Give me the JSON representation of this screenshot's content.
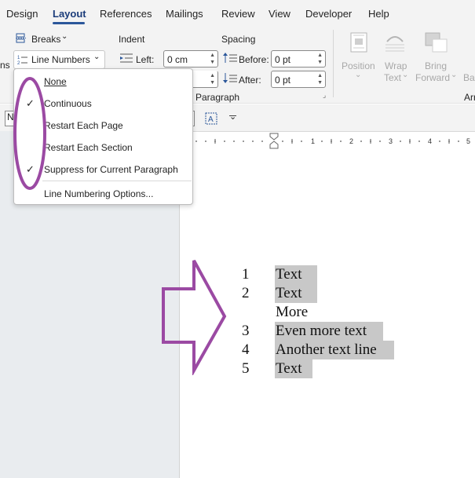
{
  "tabs": [
    "Design",
    "Layout",
    "References",
    "Mailings",
    "Review",
    "View",
    "Developer",
    "Help"
  ],
  "active_tab": "Layout",
  "ribbon": {
    "breaks_label": "Breaks",
    "line_numbers_label": "Line Numbers",
    "left_clip_text": "ns",
    "indent_title": "Indent",
    "indent_left_label": "Left:",
    "indent_left_value": "0 cm",
    "spacing_title": "Spacing",
    "spacing_before_label": "Before:",
    "spacing_before_value": "0 pt",
    "spacing_after_label": "After:",
    "spacing_after_value": "0 pt",
    "paragraph_group_label": "Paragraph",
    "position_label": "Position",
    "wrap_text_label_1": "Wrap",
    "wrap_text_label_2": "Text",
    "bring_forward_label_1": "Bring",
    "bring_forward_label_2": "Forward",
    "clip_back": "Bac",
    "clip_arr": "Arr"
  },
  "line_numbers_menu": {
    "items": [
      {
        "label": "None",
        "checked": false
      },
      {
        "label": "Continuous",
        "checked": true
      },
      {
        "label": "Restart Each Page",
        "checked": false
      },
      {
        "label": "Restart Each Section",
        "checked": false
      },
      {
        "label": "Suppress for Current Paragraph",
        "checked": true
      }
    ],
    "options_label": "Line Numbering Options..."
  },
  "document": {
    "lines": [
      {
        "number": "1",
        "text": "Text"
      },
      {
        "number": "2",
        "text": "Text"
      },
      {
        "number": "",
        "text": "More"
      },
      {
        "number": "3",
        "text": "Even more text"
      },
      {
        "number": "4",
        "text": "Another text line"
      },
      {
        "number": "5",
        "text": "Text"
      }
    ]
  },
  "annotation_color": "#9b4aa3",
  "accent_color": "#2b579a"
}
